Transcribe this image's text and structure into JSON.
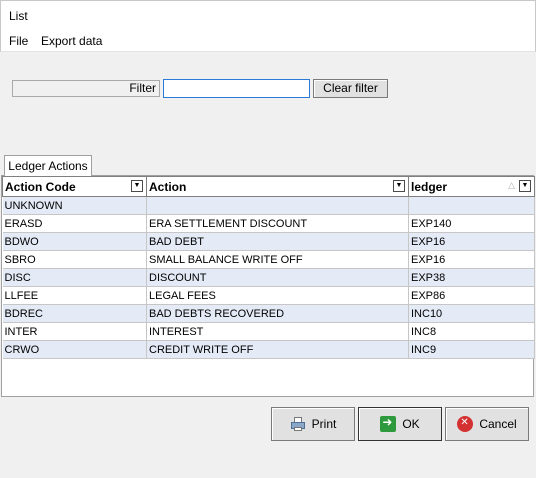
{
  "window": {
    "title": "List"
  },
  "menu": {
    "items": [
      "File",
      "Export data"
    ]
  },
  "filter": {
    "label": "Filter",
    "value": "",
    "clear_label": "Clear filter"
  },
  "tabs": [
    {
      "label": "Ledger Actions"
    }
  ],
  "grid": {
    "columns": [
      "Action Code",
      "Action",
      "ledger"
    ],
    "rows": [
      [
        "UNKNOWN",
        "",
        ""
      ],
      [
        "ERASD",
        "ERA SETTLEMENT DISCOUNT",
        "EXP140"
      ],
      [
        "BDWO",
        "BAD DEBT",
        "EXP16"
      ],
      [
        "SBRO",
        "SMALL BALANCE WRITE OFF",
        "EXP16"
      ],
      [
        "DISC",
        "DISCOUNT",
        "EXP38"
      ],
      [
        "LLFEE",
        "LEGAL FEES",
        "EXP86"
      ],
      [
        "BDREC",
        "BAD DEBTS RECOVERED",
        "INC10"
      ],
      [
        "INTER",
        "INTEREST",
        "INC8"
      ],
      [
        "CRWO",
        "CREDIT WRITE OFF",
        "INC9"
      ]
    ]
  },
  "buttons": {
    "print": "Print",
    "ok": "OK",
    "cancel": "Cancel"
  },
  "colors": {
    "row_alt": "#e4ebf7",
    "focus_border": "#2c7ad6",
    "ok_icon": "#2e9a3d",
    "cancel_icon": "#d43131"
  },
  "icons": [
    "printer-icon",
    "ok-arrow-icon",
    "cancel-icon",
    "dropdown-icon",
    "sort-icon"
  ]
}
